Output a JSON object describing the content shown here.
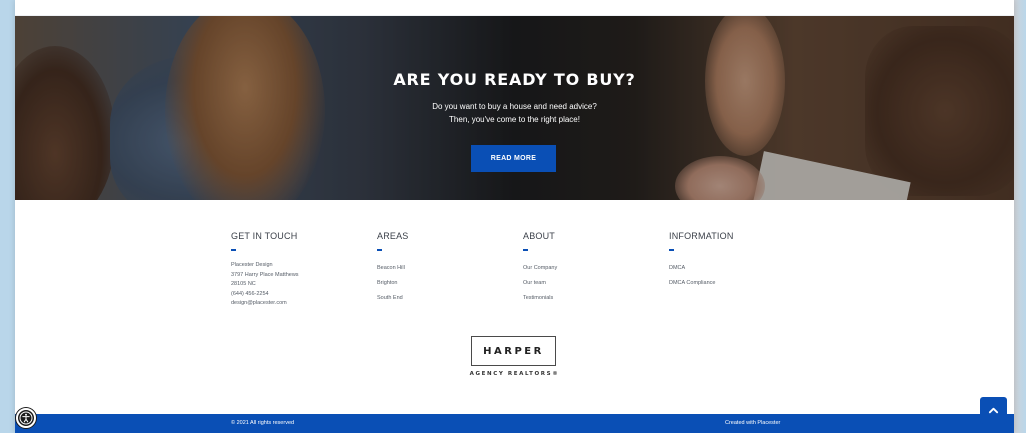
{
  "hero": {
    "title": "ARE YOU READY TO BUY?",
    "line1": "Do you want to buy a house and need advice?",
    "line2": "Then, you've come to the right place!",
    "button": "READ MORE"
  },
  "footer": {
    "columns": {
      "touch": {
        "title": "GET IN TOUCH",
        "lines": [
          "Placester Design",
          "3797 Harry Place Matthews",
          "28105 NC",
          "(644) 456-2254",
          "design@placester.com"
        ]
      },
      "areas": {
        "title": "AREAS",
        "items": [
          "Beacon Hill",
          "Brighton",
          "South End"
        ]
      },
      "about": {
        "title": "ABOUT",
        "items": [
          "Our Company",
          "Our team",
          "Testimonials"
        ]
      },
      "information": {
        "title": "INFORMATION",
        "items": [
          "DMCA",
          "DMCA Compliance"
        ]
      }
    },
    "logo": {
      "name": "HARPER",
      "subtitle": "AGENCY REALTORS®"
    },
    "copyright": "© 2021 All rights reserved",
    "credits": "Created with Placester"
  },
  "colors": {
    "accent": "#0a4fb5",
    "heading": "#3a3f48"
  },
  "icons": {
    "back_to_top": "chevron-up-icon",
    "accessibility": "accessibility-icon"
  }
}
